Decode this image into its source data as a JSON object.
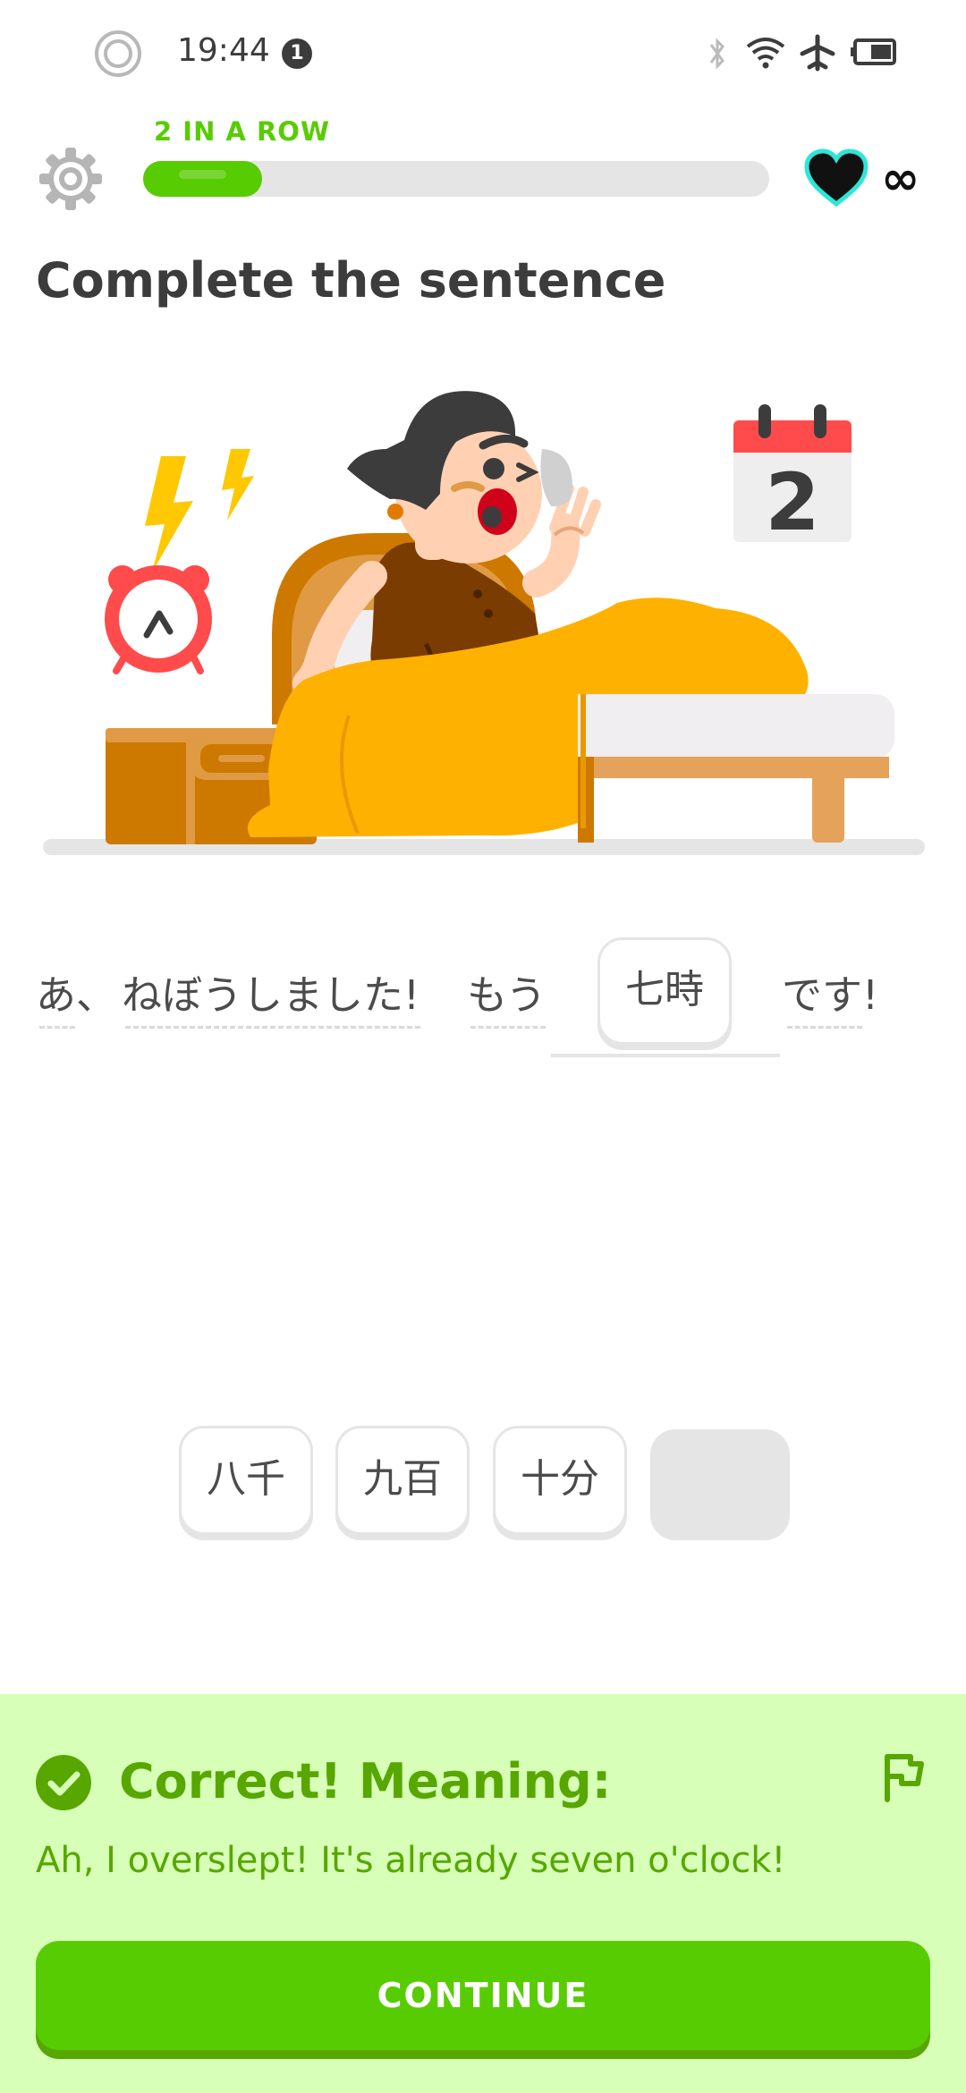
{
  "status_bar": {
    "time": "19:44",
    "notification_count": "1"
  },
  "header": {
    "streak_label": "2 IN A ROW",
    "progress_fraction": 0.19,
    "hearts": "∞"
  },
  "exercise": {
    "title": "Complete the sentence",
    "illustration": {
      "calendar_day": "2"
    },
    "sentence": {
      "word1": "あ、",
      "word2": "ねぼうしました!",
      "word3": "もう",
      "answer": "七時",
      "word4": "です!"
    },
    "word_bank": [
      "八千",
      "九百",
      "十分"
    ]
  },
  "feedback": {
    "title": "Correct! Meaning:",
    "meaning": "Ah, I overslept! It's already seven o'clock!",
    "continue_label": "CONTINUE"
  },
  "colors": {
    "accent": "#58cc02",
    "accent_dark": "#58a700",
    "feedback_bg": "#d7ffb8"
  }
}
